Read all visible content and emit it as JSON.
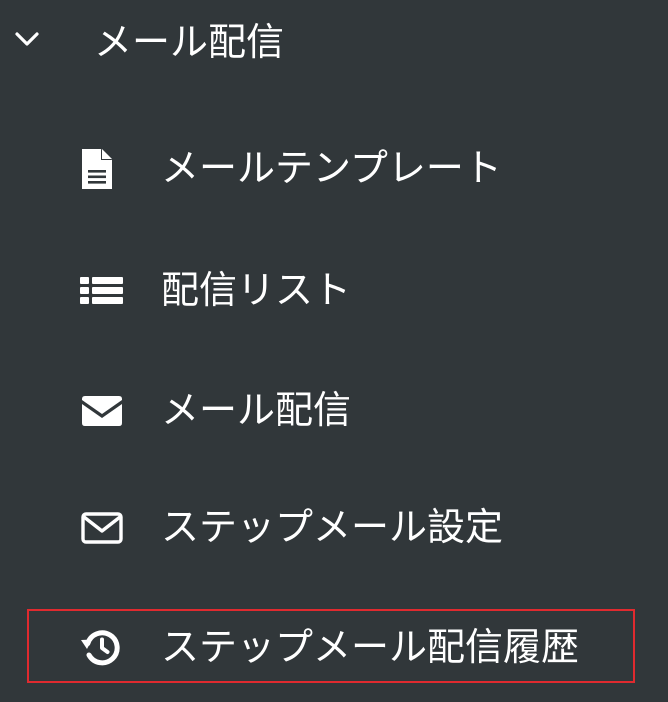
{
  "section": {
    "title": "メール配信",
    "expanded_icon": "chevron-down-icon"
  },
  "menu": {
    "items": [
      {
        "label": "メールテンプレート",
        "icon": "document-icon"
      },
      {
        "label": "配信リスト",
        "icon": "list-icon"
      },
      {
        "label": "メール配信",
        "icon": "envelope-filled-icon"
      },
      {
        "label": "ステップメール設定",
        "icon": "envelope-outline-icon"
      },
      {
        "label": "ステップメール配信履歴",
        "icon": "history-icon",
        "highlighted": true
      }
    ]
  },
  "colors": {
    "background": "#31373a",
    "text": "#ffffff",
    "highlight_border": "#e02a2f"
  }
}
